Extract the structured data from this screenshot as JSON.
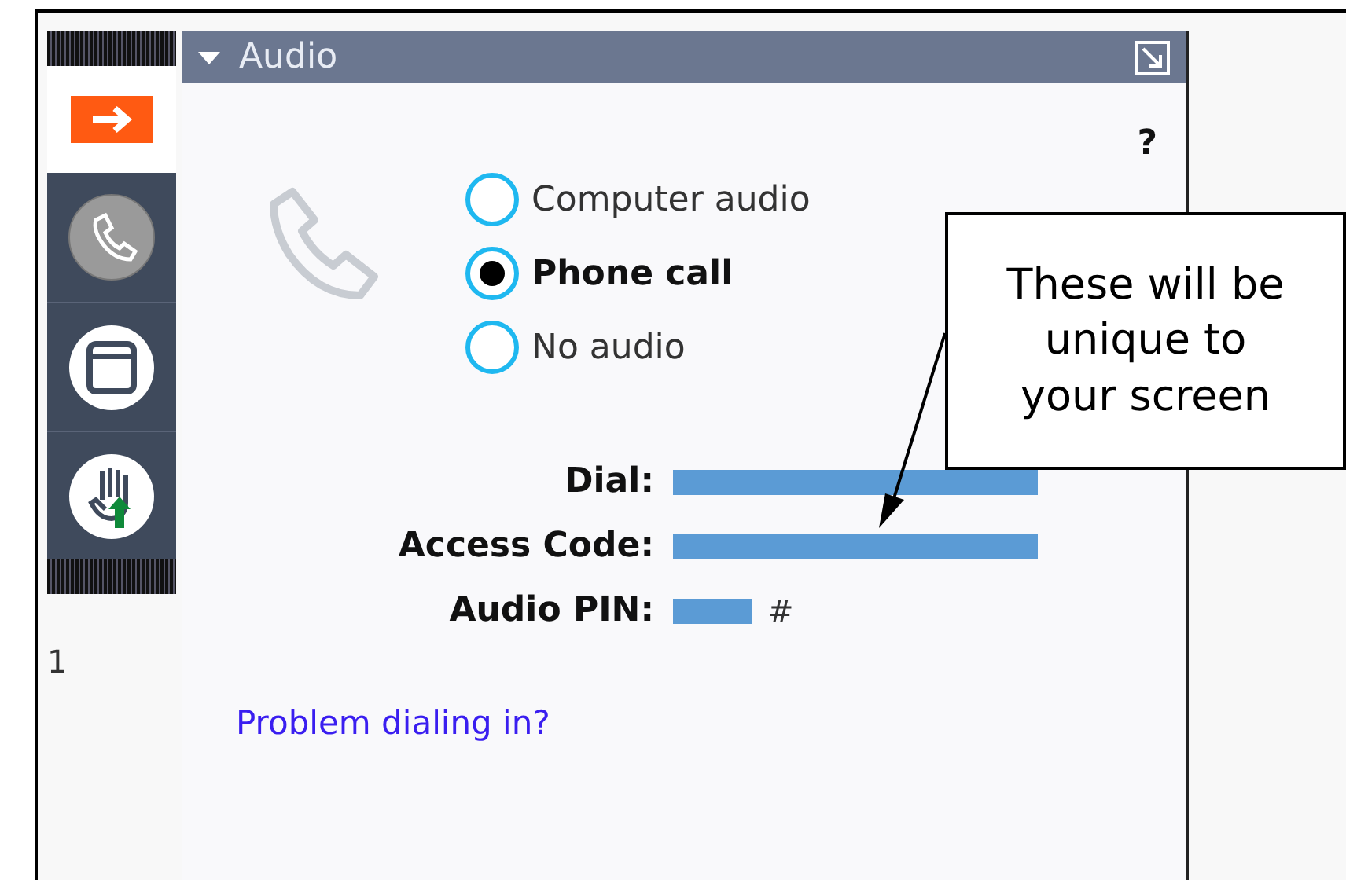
{
  "toolbar": {
    "items": [
      {
        "kind": "arrow",
        "selected": true
      },
      {
        "kind": "phone",
        "selected": false
      },
      {
        "kind": "window",
        "selected": false
      },
      {
        "kind": "hand",
        "selected": false
      }
    ]
  },
  "side_text": "1",
  "panel": {
    "title": "Audio",
    "expanded": true,
    "help": "?",
    "options": [
      {
        "label": "Computer audio",
        "selected": false
      },
      {
        "label": "Phone call",
        "selected": true
      },
      {
        "label": "No audio",
        "selected": false
      }
    ],
    "details": [
      {
        "label": "Dial:",
        "redacted": true
      },
      {
        "label": "Access Code:",
        "redacted": true
      },
      {
        "label": "Audio PIN:",
        "redacted": true,
        "suffix": "#"
      }
    ],
    "link": "Problem dialing in?"
  },
  "callout": {
    "text": "These will be unique to your screen"
  }
}
